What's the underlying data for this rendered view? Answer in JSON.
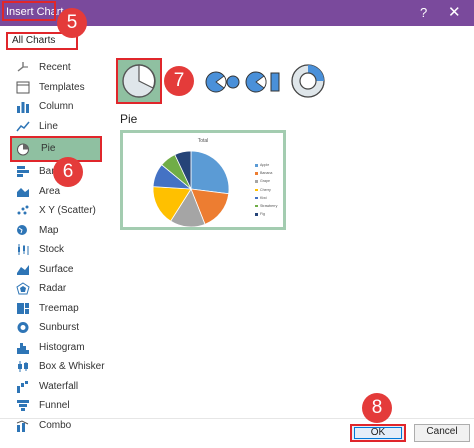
{
  "window": {
    "title": "Insert Chart",
    "help_glyph": "?",
    "close_glyph": "✕"
  },
  "tabs": {
    "all_charts": "All Charts"
  },
  "sidebar": {
    "items": [
      {
        "label": "Recent",
        "icon": "recent-icon"
      },
      {
        "label": "Templates",
        "icon": "templates-icon"
      },
      {
        "label": "Column",
        "icon": "column-chart-icon"
      },
      {
        "label": "Line",
        "icon": "line-chart-icon"
      },
      {
        "label": "Pie",
        "icon": "pie-chart-icon",
        "selected": true
      },
      {
        "label": "Bar",
        "icon": "bar-chart-icon"
      },
      {
        "label": "Area",
        "icon": "area-chart-icon"
      },
      {
        "label": "X Y (Scatter)",
        "icon": "scatter-chart-icon"
      },
      {
        "label": "Map",
        "icon": "map-chart-icon"
      },
      {
        "label": "Stock",
        "icon": "stock-chart-icon"
      },
      {
        "label": "Surface",
        "icon": "surface-chart-icon"
      },
      {
        "label": "Radar",
        "icon": "radar-chart-icon"
      },
      {
        "label": "Treemap",
        "icon": "treemap-chart-icon"
      },
      {
        "label": "Sunburst",
        "icon": "sunburst-chart-icon"
      },
      {
        "label": "Histogram",
        "icon": "histogram-chart-icon"
      },
      {
        "label": "Box & Whisker",
        "icon": "box-whisker-chart-icon"
      },
      {
        "label": "Waterfall",
        "icon": "waterfall-chart-icon"
      },
      {
        "label": "Funnel",
        "icon": "funnel-chart-icon"
      },
      {
        "label": "Combo",
        "icon": "combo-chart-icon"
      }
    ]
  },
  "main": {
    "heading": "Pie",
    "subtypes": [
      "pie-subtype-icon",
      "pie-of-pie-subtype-icon",
      "bar-of-pie-subtype-icon",
      "doughnut-subtype-icon"
    ],
    "preview": {
      "title": "Total",
      "legend": [
        "Apple",
        "Banana",
        "Grape",
        "Cherry",
        "Kiwi",
        "Strawberry",
        "Fig"
      ]
    }
  },
  "callouts": [
    "5",
    "6",
    "7",
    "8"
  ],
  "footer": {
    "ok_label": "OK",
    "cancel_label": "Cancel"
  },
  "colors": {
    "titlebar": "#7a4a9c",
    "selection": "#8fc0a1",
    "highlight": "#e0262b",
    "callout": "#e43b3a",
    "chart_blue": "#4a90d9"
  },
  "chart_data": {
    "type": "pie",
    "title": "Total",
    "categories": [
      "Apple",
      "Banana",
      "Grape",
      "Cherry",
      "Kiwi",
      "Strawberry",
      "Fig"
    ],
    "values": [
      27,
      17,
      15,
      17,
      10,
      7,
      7
    ],
    "colors": [
      "#5b9bd5",
      "#ed7d31",
      "#a5a5a5",
      "#ffc000",
      "#4472c4",
      "#70ad47",
      "#264478"
    ]
  }
}
